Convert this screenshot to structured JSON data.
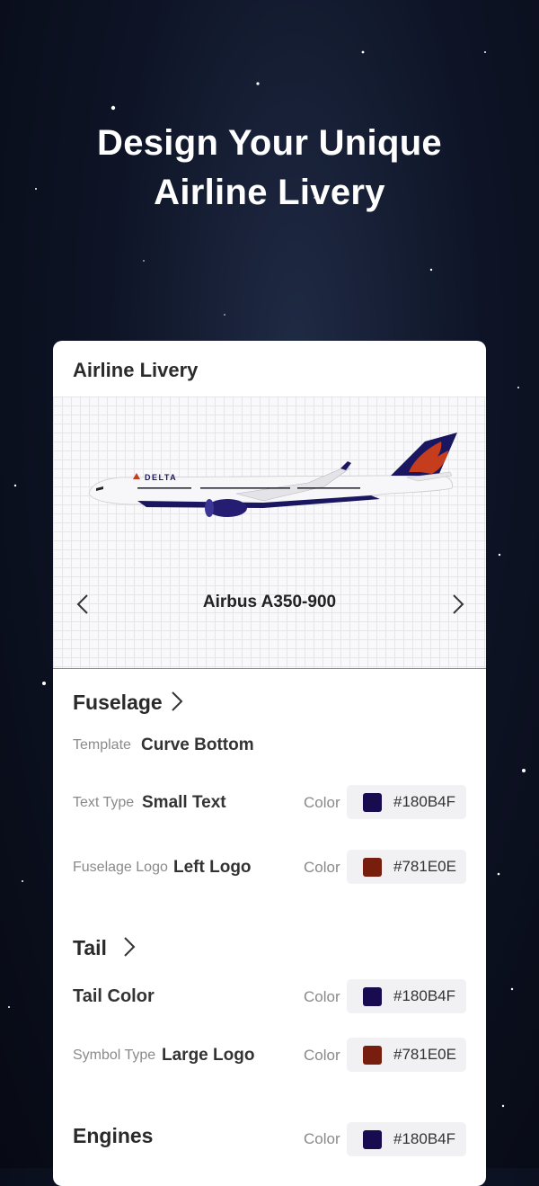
{
  "headline": {
    "line1": "Design Your Unique",
    "line2": "Airline Livery"
  },
  "card": {
    "title": "Airline Livery",
    "preview": {
      "model": "Airbus A350-900",
      "plane_brand": "DELTA"
    },
    "fuselage": {
      "title": "Fuselage",
      "template_label": "Template",
      "template_value": "Curve Bottom",
      "text_type_label": "Text Type",
      "text_type_value": "Small Text",
      "text_color_label": "Color",
      "text_color_hex": "#180B4F",
      "logo_label": "Fuselage Logo",
      "logo_value": "Left Logo",
      "logo_color_label": "Color",
      "logo_color_hex": "#781E0E"
    },
    "tail": {
      "title": "Tail",
      "tail_color_label": "Tail Color",
      "tail_color_label2": "Color",
      "tail_color_hex": "#180B4F",
      "symbol_label": "Symbol Type",
      "symbol_value": "Large Logo",
      "symbol_color_label": "Color",
      "symbol_color_hex": "#781E0E"
    },
    "engines": {
      "title": "Engines",
      "color_label": "Color",
      "color_hex": "#180B4F"
    }
  },
  "colors": {
    "navy": "#180B4F",
    "rust": "#781E0E"
  }
}
